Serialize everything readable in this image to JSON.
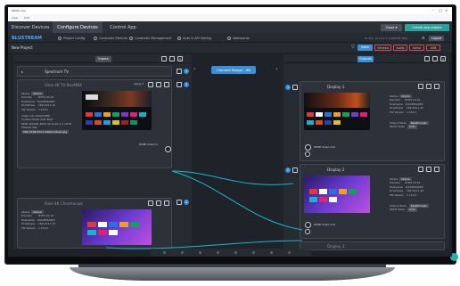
{
  "window": {
    "title": "BB/NX App",
    "menu": [
      "View",
      "Edit"
    ]
  },
  "tabs": [
    "Discover Devices",
    "Configure Devices",
    "Control App"
  ],
  "header": {
    "close_label": "Close",
    "create_label": "Create app project"
  },
  "toolbar": {
    "logo": "BLUSTREAM",
    "nav": [
      "Project Config",
      "Controller Devices",
      "Controller Management",
      "Auto & API Setting",
      "Walkwords"
    ],
    "device_info": "IP: IP4: 10.10.1.1 (UXDCDE 900)",
    "logout": "Logout"
  },
  "project": {
    "title": "New Project",
    "filters": [
      "Video",
      "Infrared",
      "Audio",
      "Serial",
      "USB"
    ]
  },
  "labels": {
    "status": "Status",
    "encoder": "Encoder",
    "decoder": "Decoder",
    "hostname": "Hostname",
    "ip": "IP Address",
    "fw": "FW Version",
    "video_info": "Video Info",
    "content_mode": "Content Mode",
    "edid": "EDID",
    "preview_url": "Preview URL",
    "output_mode": "Output Mode",
    "hdcp_mode": "HDCP Mode"
  },
  "center": {
    "connect_label": "Connect Range - Alt"
  },
  "left": {
    "header_btn": "Inputs",
    "group": {
      "title": "Spectrum TV",
      "index": "1"
    },
    "devices": [
      {
        "name": "View 4K TV BoxMNX",
        "index": "1",
        "mode": "Apply",
        "status": "Online",
        "mac": "IP:IP4 10.10",
        "hostname": "IOACBF4A0DF",
        "ip": "169.254.1.10",
        "fw": "1.15.01",
        "video_info": "1920x1080",
        "content_mode": "Auto Best",
        "edid": "4K2160_60Hz 4K Audio 2.1 LPCM",
        "preview_url": "http://169.254.1.10/thumbnail.jpg",
        "port_label": "HDMI Video In"
      },
      {
        "name": "Pixel 4K Chromecast",
        "index": "2",
        "status": "Online",
        "mac": "IP:IP4 10.10",
        "hostname": "IOACBF4A0E2",
        "ip": "169.254.1.11",
        "fw": "1.15.01"
      }
    ]
  },
  "right": {
    "header_btn": "Outputs",
    "devices": [
      {
        "name": "Display 1",
        "index": "1",
        "status": "Online",
        "mac": "IP:IP4 10.10",
        "hostname": "IOACBF4A0E5",
        "ip": "169.254.1.21",
        "fw": "1.15.01",
        "output_mode": "Passthrough",
        "hdcp_mode": "Auto",
        "port_label": "HDMI Video Out"
      },
      {
        "name": "Display 2",
        "index": "2",
        "status": "Online",
        "mac": "IP:IP4 10.10",
        "hostname": "IOACBF4A0E6",
        "ip": "169.254.1.22",
        "fw": "1.15.01",
        "output_mode": "Passthrough",
        "hdcp_mode": "Auto",
        "port_label": "HDMI Video Out"
      },
      {
        "name": "Display 3"
      }
    ]
  }
}
